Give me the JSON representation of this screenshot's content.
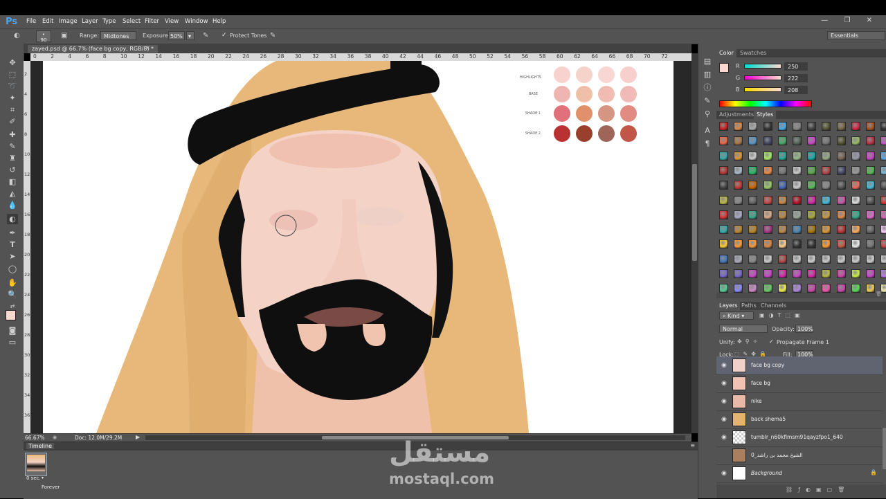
{
  "app": {
    "logo": "Ps"
  },
  "menu": [
    "File",
    "Edit",
    "Image",
    "Layer",
    "Type",
    "Select",
    "Filter",
    "View",
    "Window",
    "Help"
  ],
  "window_controls": "— ❐ ✕",
  "options": {
    "brush_size": "90",
    "range_label": "Range:",
    "range_value": "Midtones",
    "exposure_label": "Exposure:",
    "exposure_value": "50%",
    "protect_tones_label": "Protect Tones",
    "workspace": "Essentials"
  },
  "document": {
    "tab_title": "zayed.psd @ 66.7% (face bg copy, RGB/8) *",
    "zoom": "66.67%",
    "doc_size": "Doc: 12.0M/29.2M",
    "ruler_h": [
      "0",
      "2",
      "4",
      "6",
      "8",
      "10",
      "12",
      "14",
      "16",
      "18",
      "20",
      "22",
      "24",
      "26",
      "28",
      "30",
      "32",
      "34",
      "36",
      "38",
      "40",
      "42",
      "44",
      "46",
      "48",
      "50",
      "52",
      "54",
      "56",
      "58",
      "60",
      "62",
      "64",
      "66",
      "68",
      "70",
      "72"
    ],
    "ruler_v": [
      "2",
      "4",
      "6",
      "8",
      "10",
      "12",
      "14",
      "16",
      "18",
      "20",
      "22",
      "24",
      "26",
      "28",
      "30",
      "32",
      "34",
      "36"
    ]
  },
  "palette_card": {
    "rows": [
      {
        "label": "HIGHLIGHTS",
        "colors": [
          "#f7d2cf",
          "#f6d3c9",
          "#f8d6d3",
          "#f7d0cd"
        ]
      },
      {
        "label": "BASE",
        "colors": [
          "#efb5b3",
          "#efbfaa",
          "#efbbb2",
          "#efbab8"
        ]
      },
      {
        "label": "SHADE 1",
        "colors": [
          "#e0707a",
          "#e0906a",
          "#d69483",
          "#e08c82"
        ]
      },
      {
        "label": "SHADE 2",
        "colors": [
          "#b83232",
          "#98402c",
          "#9e6558",
          "#c05548"
        ]
      }
    ]
  },
  "timeline": {
    "title": "Timeline",
    "frame_delay": "0 sec.",
    "loop": "Forever"
  },
  "color_panel": {
    "tabs": [
      "Color",
      "Swatches"
    ],
    "channels": [
      {
        "label": "R",
        "value": "250"
      },
      {
        "label": "G",
        "value": "222"
      },
      {
        "label": "B",
        "value": "208"
      }
    ],
    "foreground": "#fadad0"
  },
  "styles_panel": {
    "tabs": [
      "Adjustments",
      "Styles"
    ]
  },
  "layers_panel": {
    "tabs": [
      "Layers",
      "Paths",
      "Channels"
    ],
    "kind": "Kind",
    "blend_mode": "Normal",
    "opacity_label": "Opacity:",
    "opacity": "100%",
    "unify_label": "Unify:",
    "propagate_label": "Propagate Frame 1",
    "lock_label": "Lock:",
    "fill_label": "Fill:",
    "fill": "100%",
    "layers": [
      {
        "name": "face bg copy",
        "selected": true,
        "thumb": "#f0d0c8"
      },
      {
        "name": "face bg",
        "selected": false,
        "thumb": "#f0c2b4"
      },
      {
        "name": "nike",
        "selected": false,
        "thumb": "#e9b9a8"
      },
      {
        "name": "back shema5",
        "selected": false,
        "thumb": "#e3b46e"
      },
      {
        "name": "tumblr_n60kfimsm91qayzfpo1_640",
        "selected": false,
        "thumb": "#dcdcdc"
      },
      {
        "name": "الشيخ محمد بن راشد_0",
        "selected": false,
        "thumb": "#a88060"
      },
      {
        "name": "Background",
        "selected": false,
        "thumb": "#ffffff"
      }
    ]
  },
  "watermark": {
    "arabic": "مستقل",
    "latin": "mostaql.com"
  }
}
